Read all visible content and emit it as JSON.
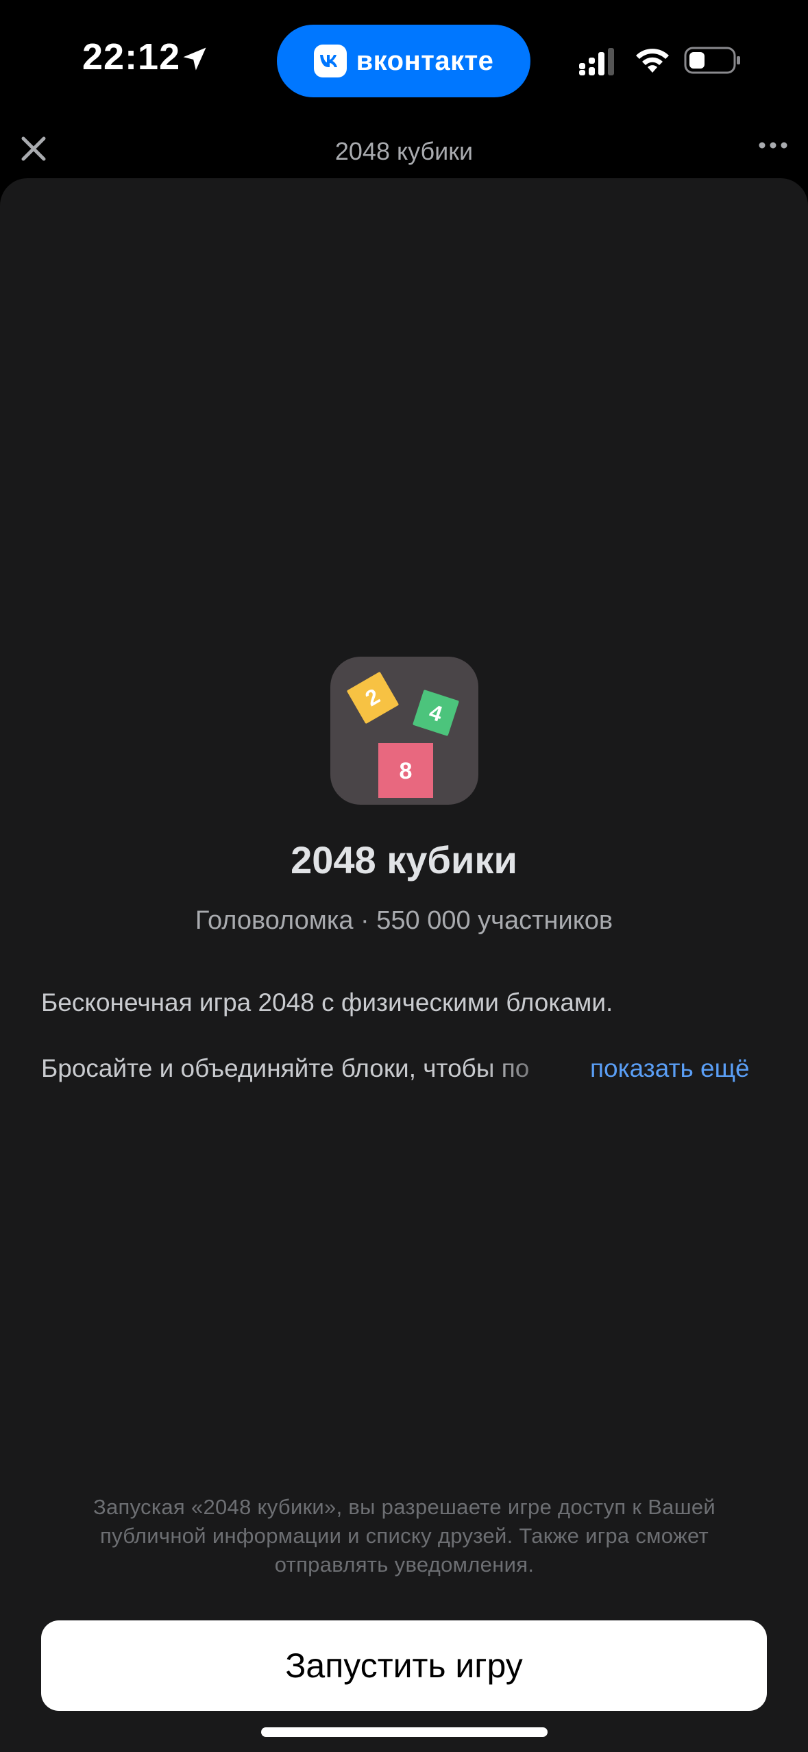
{
  "status_bar": {
    "time": "22:12",
    "pill_label": "вконтакте",
    "pill_color": "#0077ff",
    "icons": [
      "location-arrow-icon",
      "cellular-signal-icon",
      "wifi-icon",
      "battery-icon"
    ]
  },
  "header": {
    "title": "2048 кубики",
    "close_icon": "close-icon",
    "more_icon": "more-horizontal-icon"
  },
  "app": {
    "tiles": [
      "2",
      "4",
      "8"
    ],
    "tile_colors": [
      "#f7c243",
      "#4cc47c",
      "#e8687f"
    ],
    "title": "2048 кубики",
    "meta": "Головоломка · 550 000 участников",
    "description_line1": "Бесконечная игра 2048 с физическими блоками.",
    "description_line2": "Бросайте и объединяйте блоки, чтобы по",
    "show_more": "показать ещё"
  },
  "footer": {
    "permission_note": "Запуская «2048 кубики», вы разрешаете игре доступ к Вашей публичной информации и списку друзей. Также игра сможет отправлять уведомления.",
    "launch_button": "Запустить игру"
  }
}
